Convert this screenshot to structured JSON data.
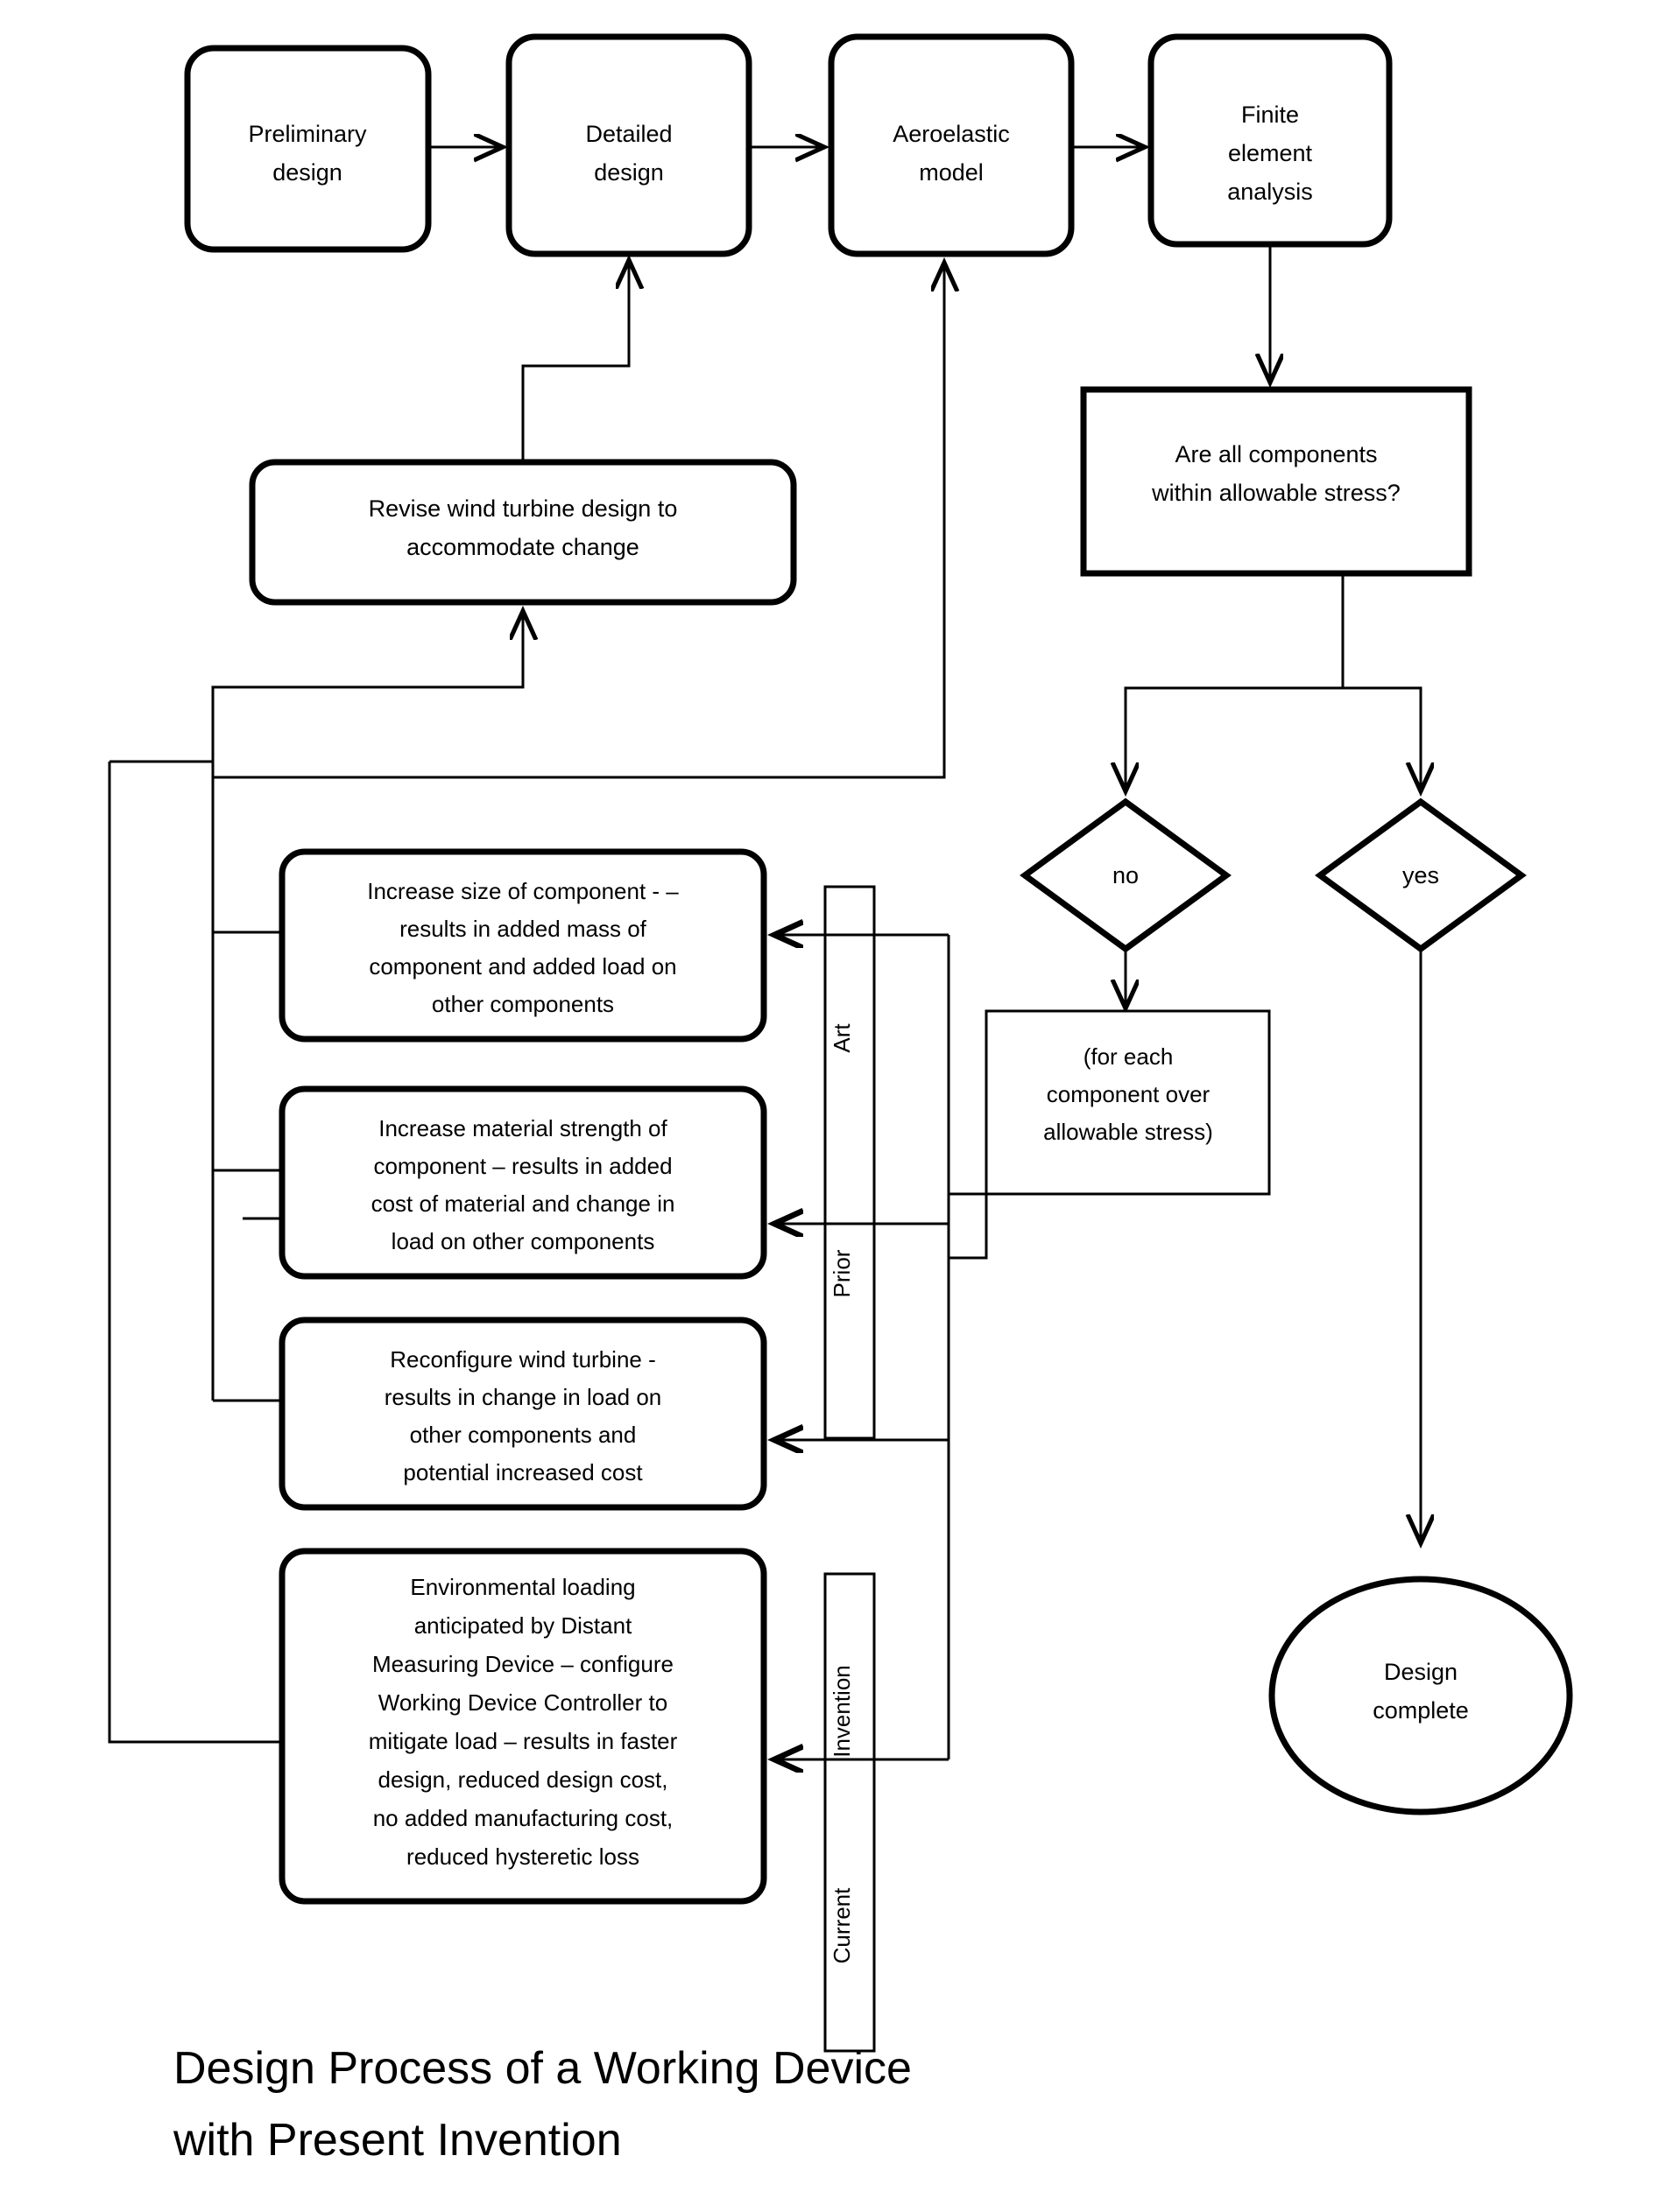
{
  "diagram": {
    "caption_line1": "Design Process of a Working Device",
    "caption_line2": "with Present Invention",
    "nodes": {
      "preliminary_design": {
        "lines": [
          "Preliminary",
          "design"
        ]
      },
      "detailed_design": {
        "lines": [
          "Detailed",
          "design"
        ]
      },
      "aeroelastic_model": {
        "lines": [
          "Aeroelastic",
          "model"
        ]
      },
      "finite_element_analysis": {
        "lines": [
          "Finite",
          "element",
          "analysis"
        ]
      },
      "stress_question": {
        "lines": [
          "Are all components",
          "within allowable stress?"
        ]
      },
      "revise_design": {
        "lines": [
          "Revise wind turbine design to",
          "accommodate change"
        ]
      },
      "decision_no": {
        "label": "no"
      },
      "decision_yes": {
        "label": "yes"
      },
      "for_each_component": {
        "lines": [
          "(for each",
          "component over",
          "allowable stress)"
        ]
      },
      "design_complete": {
        "lines": [
          "Design",
          "complete"
        ]
      },
      "option_increase_size": {
        "lines": [
          "Increase size of component - –",
          "results in added mass of",
          "component and added load on",
          "other components"
        ]
      },
      "option_increase_strength": {
        "lines": [
          "Increase material strength  of",
          "component – results in added",
          "cost of material and change in",
          "load on other components"
        ]
      },
      "option_reconfigure": {
        "lines": [
          "Reconfigure wind turbine  -",
          "results in change in load on",
          "other components and",
          "potential increased cost"
        ]
      },
      "option_environmental": {
        "lines": [
          "Environmental loading",
          "anticipated by Distant",
          "Measuring Device – configure",
          "Working Device Controller to",
          "mitigate load – results in faster",
          "design, reduced design cost,",
          "no added manufacturing cost,",
          "reduced hysteretic loss"
        ]
      }
    },
    "bracket_labels": {
      "prior_art_top": "Art",
      "prior_art_bottom": "Prior",
      "current_invention_top": "Invention",
      "current_invention_bottom": "Current"
    },
    "colors": {
      "stroke": "#000000",
      "fill": "#ffffff",
      "background": "#ffffff"
    }
  }
}
